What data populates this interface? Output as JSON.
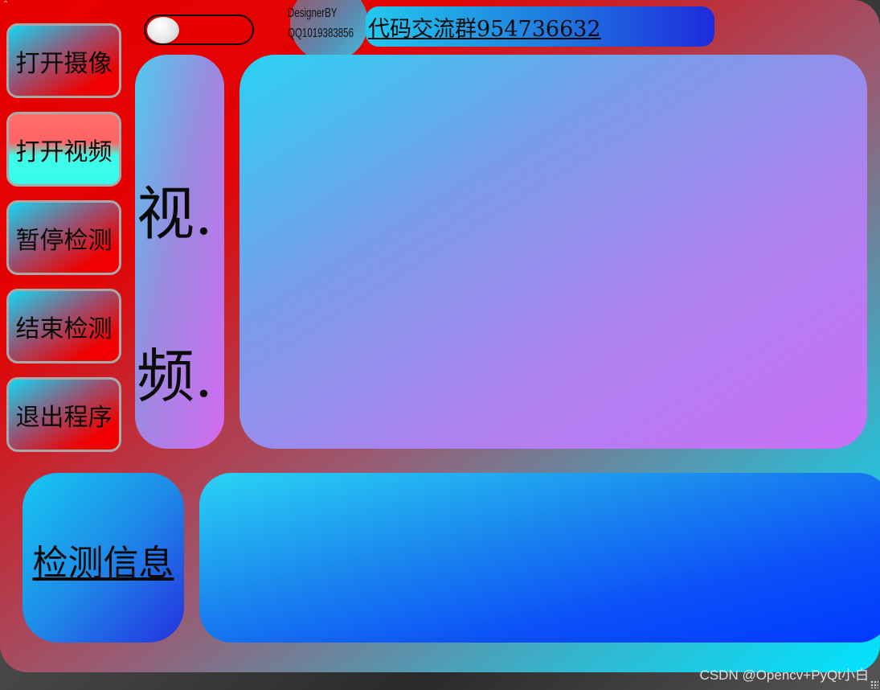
{
  "sidebar": {
    "buttons": [
      {
        "label": "打开摄像"
      },
      {
        "label": "打开视频"
      },
      {
        "label": "暂停检测"
      },
      {
        "label": "结束检测"
      },
      {
        "label": "退出程序"
      }
    ]
  },
  "header": {
    "designer_line1": "DesignerBY",
    "designer_line2": "QQ1019383856",
    "group_link": "代码交流群954736632"
  },
  "video_panel": {
    "char1": "视.",
    "char2": "频."
  },
  "info_panel": {
    "label": "检测信息"
  },
  "watermark": "CSDN @Opencv+PyQt小白",
  "colors": {
    "window_red": "#e80000",
    "window_cyan": "#00e4ff",
    "active_button_top": "#ff6464",
    "active_button_bottom": "#37fbe8"
  }
}
